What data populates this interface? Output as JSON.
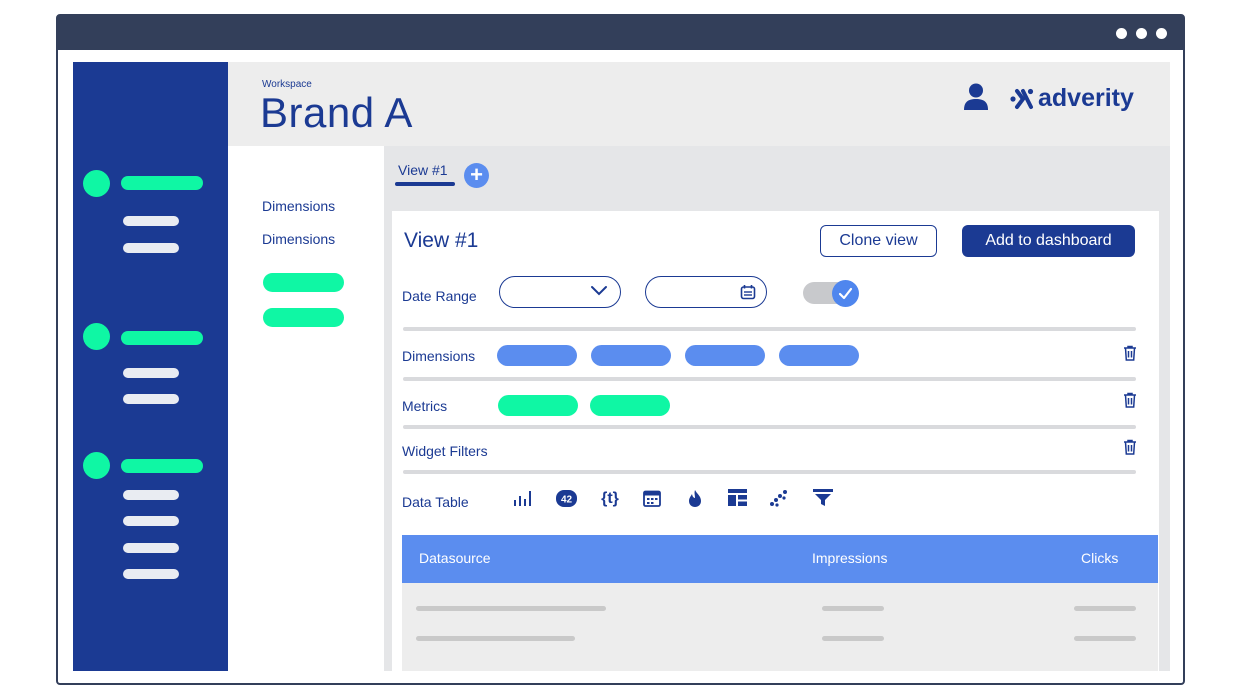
{
  "header": {
    "workspace_label": "Workspace",
    "workspace_title": "Brand A",
    "brand_name": "adverity"
  },
  "sidebar_panel": {
    "links": [
      "Dimensions",
      "Dimensions"
    ]
  },
  "tabs": [
    {
      "label": "View #1",
      "active": true
    }
  ],
  "view": {
    "title": "View #1",
    "clone_label": "Clone view",
    "add_label": "Add to dashboard",
    "date_range_label": "Date Range",
    "dimensions_label": "Dimensions",
    "metrics_label": "Metrics",
    "widget_filters_label": "Widget Filters",
    "data_table_label": "Data Table",
    "toggle_on": true
  },
  "widget_icons": [
    "bar-chart-icon",
    "number-42-icon",
    "text-braces-icon",
    "calendar-icon",
    "flame-icon",
    "layout-grid-icon",
    "scatter-icon",
    "funnel-icon"
  ],
  "widget_icon_number_text": "42",
  "widget_icon_braces_text": "{t}",
  "table": {
    "columns": [
      "Datasource",
      "Impressions",
      "Clicks"
    ]
  },
  "colors": {
    "navy": "#1b3a93",
    "green": "#0ff7a4",
    "blue": "#5b8def",
    "titlebar": "#333f5a"
  }
}
